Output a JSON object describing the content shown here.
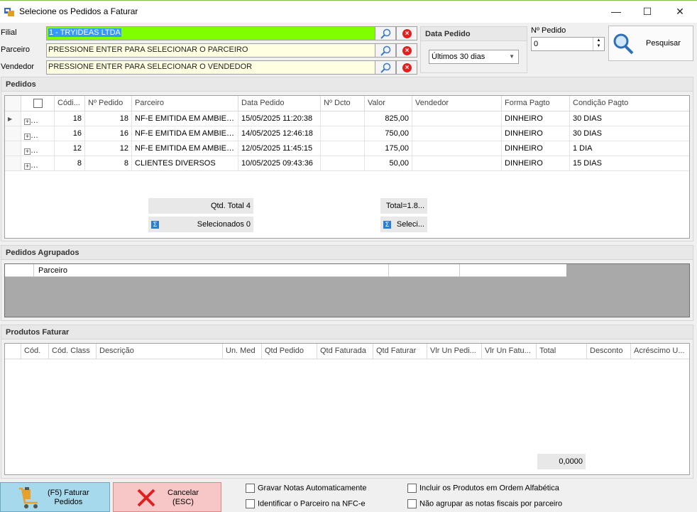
{
  "window": {
    "title": "Selecione os Pedidos a Faturar"
  },
  "filters": {
    "filial_label": "Filial",
    "filial_value": "1 - TRYIDEAS LTDA",
    "parceiro_label": "Parceiro",
    "parceiro_value": "PRESSIONE ENTER PARA SELECIONAR O PARCEIRO",
    "vendedor_label": "Vendedor",
    "vendedor_value": "PRESSIONE ENTER PARA SELECIONAR O VENDEDOR",
    "data_pedido_label": "Data Pedido",
    "data_pedido_value": "Últimos 30 dias",
    "num_pedido_label": "Nº Pedido",
    "num_pedido_value": "0",
    "search_label": "Pesquisar"
  },
  "pedidos": {
    "title": "Pedidos",
    "columns": [
      "Códi...",
      "Nº Pedido",
      "Parceiro",
      "Data Pedido",
      "Nº Dcto",
      "Valor",
      "Vendedor",
      "Forma Pagto",
      "Condição Pagto"
    ],
    "rows": [
      {
        "codigo": "18",
        "pedido": "18",
        "parceiro": "NF-E EMITIDA EM AMBIEN...",
        "data": "15/05/2025 11:20:38",
        "dcto": "",
        "valor": "825,00",
        "vendedor": "",
        "forma": "DINHEIRO",
        "condicao": "30 DIAS"
      },
      {
        "codigo": "16",
        "pedido": "16",
        "parceiro": "NF-E EMITIDA EM AMBIEN...",
        "data": "14/05/2025 12:46:18",
        "dcto": "",
        "valor": "750,00",
        "vendedor": "",
        "forma": "DINHEIRO",
        "condicao": "30 DIAS"
      },
      {
        "codigo": "12",
        "pedido": "12",
        "parceiro": "NF-E EMITIDA EM AMBIEN...",
        "data": "12/05/2025 11:45:15",
        "dcto": "",
        "valor": "175,00",
        "vendedor": "",
        "forma": "DINHEIRO",
        "condicao": "1 DIA"
      },
      {
        "codigo": "8",
        "pedido": "8",
        "parceiro": "CLIENTES DIVERSOS",
        "data": "10/05/2025 09:43:36",
        "dcto": "",
        "valor": "50,00",
        "vendedor": "",
        "forma": "DINHEIRO",
        "condicao": "15 DIAS"
      }
    ],
    "qtd_total": "Qtd. Total 4",
    "selecionados": "Selecionados 0",
    "total": "Total=1.8...",
    "seleci": "Seleci..."
  },
  "agrupados": {
    "title": "Pedidos Agrupados",
    "col_parceiro": "Parceiro"
  },
  "produtos": {
    "title": "Produtos Faturar",
    "columns": [
      "Cód.",
      "Cód. Class",
      "Descrição",
      "Un. Med",
      "Qtd Pedido",
      "Qtd Faturada",
      "Qtd Faturar",
      "Vlr Un Pedi...",
      "Vlr Un Fatu...",
      "Total",
      "Desconto",
      "Acréscimo U..."
    ],
    "total": "0,0000"
  },
  "footer": {
    "faturar_label": "(F5) Faturar\nPedidos",
    "cancelar_label": "Cancelar\n(ESC)",
    "opt_gravar": "Gravar Notas Automaticamente",
    "opt_identificar": "Identificar o Parceiro na NFC-e",
    "opt_ordem": "Incluir os Produtos em Ordem Alfabética",
    "opt_nao_agrupar": "Não agrupar as notas fiscais por parceiro"
  }
}
